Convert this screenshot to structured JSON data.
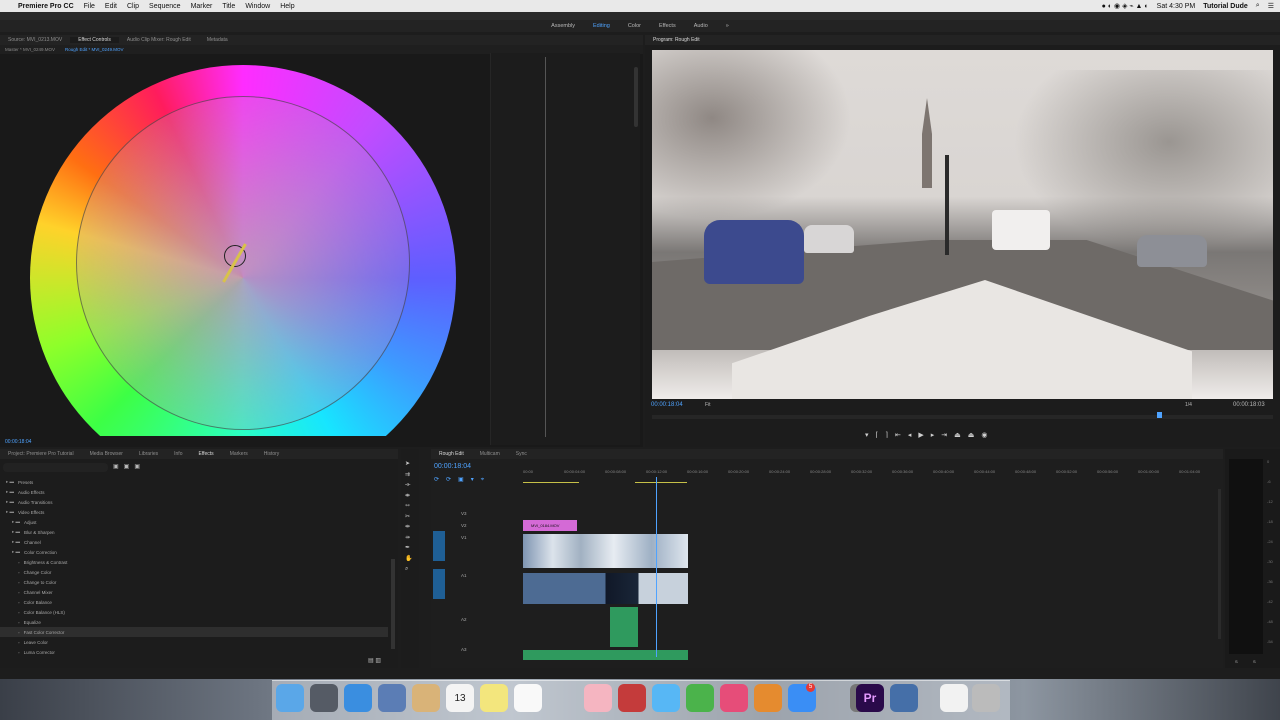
{
  "menubar": {
    "apple": "",
    "app_name": "Premiere Pro CC",
    "items": [
      "File",
      "Edit",
      "Clip",
      "Sequence",
      "Marker",
      "Title",
      "Window",
      "Help"
    ],
    "clock": "Sat 4:30 PM",
    "user": "Tutorial Dude"
  },
  "workspaces": [
    "Assembly",
    "Editing",
    "Color",
    "Effects",
    "Audio",
    "»"
  ],
  "source_panel": {
    "tabs": [
      "Source: MVI_0213.MOV",
      "Effect Controls",
      "Audio Clip Mixer: Rough Edit",
      "Metadata"
    ],
    "subheader_left": "Master * MVI_0249.MOV",
    "subheader_clip": "Rough Edit * MVI_0249.MOV",
    "timecode_bottom": "00:00:18:04"
  },
  "program_panel": {
    "tab": "Program: Rough Edit",
    "timecode_left": "00:00:18:04",
    "fit": "Fit",
    "quality": "1/4",
    "timecode_right": "00:00:18:03"
  },
  "project_panel": {
    "tabs": [
      "Project: Premiere Pro Tutorial",
      "Media Browser",
      "Libraries",
      "Info",
      "Effects",
      "Markers",
      "History"
    ],
    "tree": [
      {
        "label": "Presets",
        "indent": 0
      },
      {
        "label": "Audio Effects",
        "indent": 0
      },
      {
        "label": "Audio Transitions",
        "indent": 0
      },
      {
        "label": "Video Effects",
        "indent": 0
      },
      {
        "label": "Adjust",
        "indent": 1
      },
      {
        "label": "Blur & Sharpen",
        "indent": 1
      },
      {
        "label": "Channel",
        "indent": 1
      },
      {
        "label": "Color Correction",
        "indent": 1
      },
      {
        "label": "Brightness & Contrast",
        "indent": 2
      },
      {
        "label": "Change Color",
        "indent": 2
      },
      {
        "label": "Change to Color",
        "indent": 2
      },
      {
        "label": "Channel Mixer",
        "indent": 2
      },
      {
        "label": "Color Balance",
        "indent": 2
      },
      {
        "label": "Color Balance (HLS)",
        "indent": 2
      },
      {
        "label": "Equalize",
        "indent": 2
      },
      {
        "label": "Fast Color Corrector",
        "indent": 2
      },
      {
        "label": "Leave Color",
        "indent": 2
      },
      {
        "label": "Luma Corrector",
        "indent": 2
      }
    ]
  },
  "timeline_panel": {
    "tabs": [
      "Rough Edit",
      "Multicam",
      "Sync"
    ],
    "timecode": "00:00:18:04",
    "ruler": [
      "00:00",
      "00:00:04:00",
      "00:00:08:00",
      "00:00:12:00",
      "00:00:16:00",
      "00:00:20:00",
      "00:00:24:00",
      "00:00:28:00",
      "00:00:32:00",
      "00:00:36:00",
      "00:00:40:00",
      "00:00:44:00",
      "00:00:48:00",
      "00:00:52:00",
      "00:00:56:00",
      "00:01:00:00",
      "00:01:04:00"
    ],
    "tracks": [
      "V3",
      "V2",
      "V1",
      "A1",
      "A2",
      "A3"
    ],
    "track_names": {
      "v1": "Video 1",
      "a1": "Audio 1",
      "a2": "Audio 2"
    },
    "clip_label": "MVI_0184.MOV"
  },
  "audio_meter": {
    "scale": [
      "0",
      "-6",
      "-12",
      "-18",
      "-24",
      "-30",
      "-36",
      "-42",
      "-48",
      "-54"
    ],
    "footer": [
      "S",
      "S"
    ]
  },
  "dock": {
    "apps": [
      "Finder",
      "Launchpad",
      "Safari",
      "Preview",
      "Contacts",
      "Calendar",
      "Notes",
      "TextEdit",
      "Photos",
      "Photo Booth",
      "Messages",
      "FaceTime",
      "iTunes",
      "iBooks",
      "App Store",
      "Instruments",
      "System Preferences",
      "Premiere Pro",
      "QuickTime",
      "Document",
      "Trash"
    ],
    "calendar_day": "13",
    "app_store_badge": "5",
    "premiere_label": "Pr"
  },
  "colors": {
    "accent": "#4fa3ff",
    "panel_bg": "#1e1e1e",
    "timeline_clip_video": "#a5b6c8",
    "timeline_clip_audio": "#2f9a5e",
    "clip_pink": "#d46ad6"
  }
}
